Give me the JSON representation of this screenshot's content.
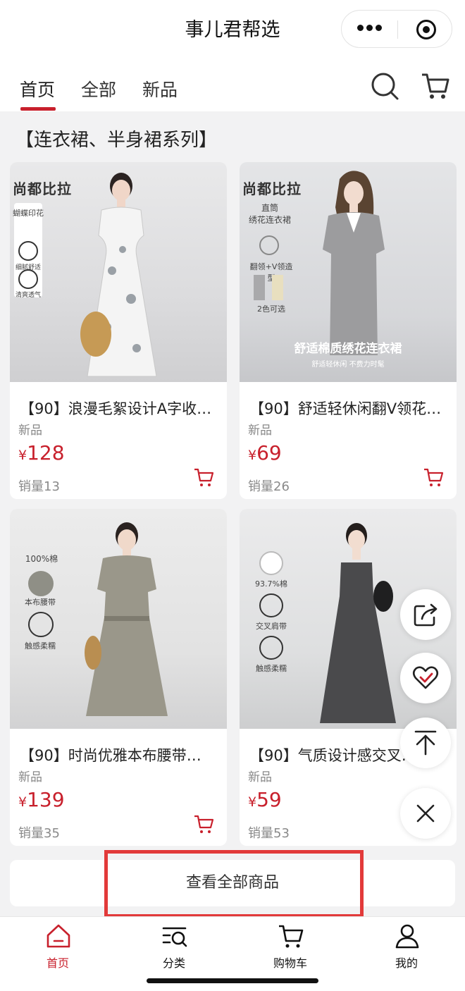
{
  "header": {
    "title": "事儿君帮选"
  },
  "tabs": [
    {
      "label": "首页"
    },
    {
      "label": "全部"
    },
    {
      "label": "新品"
    }
  ],
  "section": {
    "title": "【连衣裙、半身裙系列】"
  },
  "products": [
    {
      "name": "【90】浪漫毛絮设计A字收…",
      "tag": "新品",
      "currency": "¥",
      "price": "128",
      "sales": "销量13",
      "image": {
        "brand": "尚都比拉",
        "features": [
          "蝴蝶印花",
          "细腻舒适",
          "清爽透气"
        ]
      }
    },
    {
      "name": "【90】舒适轻休闲翻V领花…",
      "tag": "新品",
      "currency": "¥",
      "price": "69",
      "sales": "销量26",
      "image": {
        "brand": "尚都比拉",
        "headline": "直筒\n绣花连衣裙",
        "features": [
          "翻领+V领造型",
          "2色可选"
        ],
        "banner": "舒适棉质绣花连衣裙",
        "banner_sub": "舒适轻休闲    不费力时髦"
      }
    },
    {
      "name": "【90】时尚优雅本布腰带…",
      "tag": "新品",
      "currency": "¥",
      "price": "139",
      "sales": "销量35",
      "image": {
        "features": [
          "100%棉",
          "本布腰带",
          "触感柔糯"
        ]
      }
    },
    {
      "name": "【90】气质设计感交叉…",
      "tag": "新品",
      "currency": "¥",
      "price": "59",
      "sales": "销量53",
      "image": {
        "features": [
          "93.7%棉",
          "交叉肩带",
          "触感柔糯"
        ]
      }
    }
  ],
  "view_all": {
    "label": "查看全部商品"
  },
  "bottom_nav": [
    {
      "label": "首页",
      "icon": "home-icon"
    },
    {
      "label": "分类",
      "icon": "category-search-icon"
    },
    {
      "label": "购物车",
      "icon": "cart-icon"
    },
    {
      "label": "我的",
      "icon": "user-icon"
    }
  ],
  "floating": [
    "share-icon",
    "favorite-heart-icon",
    "back-to-top-icon",
    "close-icon"
  ],
  "colors": {
    "accent": "#c8202c",
    "highlight": "#e23a3a",
    "background": "#f2f2f3"
  }
}
